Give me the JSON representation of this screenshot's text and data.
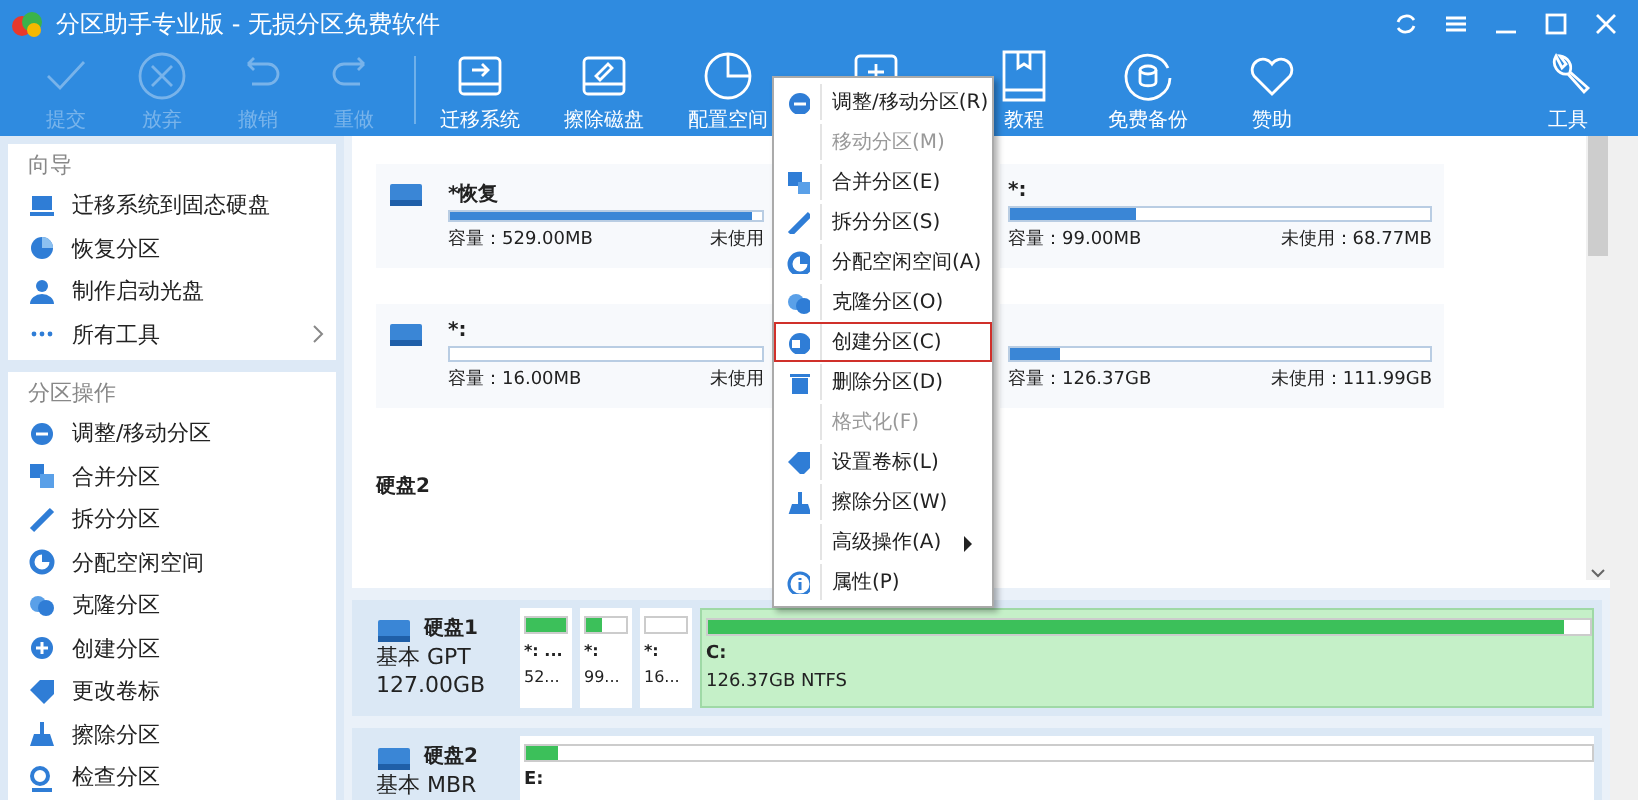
{
  "window": {
    "title": "分区助手专业版 - 无损分区免费软件"
  },
  "toolbar": {
    "items": [
      {
        "label": "提交",
        "disabled": true
      },
      {
        "label": "放弃",
        "disabled": true
      },
      {
        "label": "撤销",
        "disabled": true
      },
      {
        "label": "重做",
        "disabled": true
      },
      {
        "label": "迁移系统",
        "disabled": false
      },
      {
        "label": "擦除磁盘",
        "disabled": false
      },
      {
        "label": "配置空间",
        "disabled": false
      },
      {
        "label": "教程",
        "disabled": false
      },
      {
        "label": "免费备份",
        "disabled": false
      },
      {
        "label": "赞助",
        "disabled": false
      }
    ],
    "tools": {
      "label": "工具"
    }
  },
  "sidebar": {
    "sections": [
      {
        "title": "向导",
        "items": [
          {
            "label": "迁移系统到固态硬盘",
            "has_arrow": false
          },
          {
            "label": "恢复分区",
            "has_arrow": false
          },
          {
            "label": "制作启动光盘",
            "has_arrow": false
          },
          {
            "label": "所有工具",
            "has_arrow": true
          }
        ]
      },
      {
        "title": "分区操作",
        "items": [
          {
            "label": "调整/移动分区",
            "has_arrow": false
          },
          {
            "label": "合并分区",
            "has_arrow": false
          },
          {
            "label": "拆分分区",
            "has_arrow": false
          },
          {
            "label": "分配空闲空间",
            "has_arrow": false
          },
          {
            "label": "克隆分区",
            "has_arrow": false
          },
          {
            "label": "创建分区",
            "has_arrow": false
          },
          {
            "label": "更改卷标",
            "has_arrow": false
          },
          {
            "label": "擦除分区",
            "has_arrow": false
          },
          {
            "label": "检查分区",
            "has_arrow": false
          }
        ]
      }
    ]
  },
  "partition_cards": [
    {
      "label": "*恢复",
      "level": 0.97,
      "capacity": "容量：529.00MB",
      "unused": "未使用"
    },
    {
      "label": "*:",
      "level": 0.3,
      "capacity": "容量：99.00MB",
      "unused": "未使用：68.77MB"
    },
    {
      "label": "*:",
      "level": 0,
      "capacity": "容量：16.00MB",
      "unused": "未使用"
    },
    {
      "level": 0.12,
      "capacity": "容量：126.37GB",
      "unused": "未使用：111.99GB"
    }
  ],
  "disk_heading": "硬盘2",
  "disks": [
    {
      "name": "硬盘1",
      "type": "基本 GPT",
      "size": "127.00GB",
      "partitions": [
        {
          "label": "*: ...",
          "info": "52...",
          "level": 1,
          "selected": false
        },
        {
          "label": "*:",
          "info": "99...",
          "level": 0.4,
          "selected": false
        },
        {
          "label": "*:",
          "info": "16...",
          "level": 0,
          "selected": false
        },
        {
          "label": "C:",
          "info": "126.37GB NTFS",
          "level": 0.97,
          "selected": true
        }
      ]
    },
    {
      "name": "硬盘2",
      "type": "基本 MBR",
      "partitions": [
        {
          "label": "E:",
          "level": 0.03,
          "selected": false
        }
      ]
    }
  ],
  "context_menu": {
    "items": [
      {
        "label": "调整/移动分区(R)",
        "disabled": false,
        "selected": false,
        "submenu": false
      },
      {
        "label": "移动分区(M)",
        "disabled": true,
        "selected": false,
        "submenu": false
      },
      {
        "label": "合并分区(E)",
        "disabled": false,
        "selected": false,
        "submenu": false
      },
      {
        "label": "拆分分区(S)",
        "disabled": false,
        "selected": false,
        "submenu": false
      },
      {
        "label": "分配空闲空间(A)",
        "disabled": false,
        "selected": false,
        "submenu": false
      },
      {
        "label": "克隆分区(O)",
        "disabled": false,
        "selected": false,
        "submenu": false
      },
      {
        "label": "创建分区(C)",
        "disabled": false,
        "selected": true,
        "submenu": false
      },
      {
        "label": "删除分区(D)",
        "disabled": false,
        "selected": false,
        "submenu": false
      },
      {
        "label": "格式化(F)",
        "disabled": true,
        "selected": false,
        "submenu": false
      },
      {
        "label": "设置卷标(L)",
        "disabled": false,
        "selected": false,
        "submenu": false
      },
      {
        "label": "擦除分区(W)",
        "disabled": false,
        "selected": false,
        "submenu": false
      },
      {
        "label": "高级操作(A)",
        "disabled": false,
        "selected": false,
        "submenu": true
      },
      {
        "label": "属性(P)",
        "disabled": false,
        "selected": false,
        "submenu": false
      }
    ]
  }
}
